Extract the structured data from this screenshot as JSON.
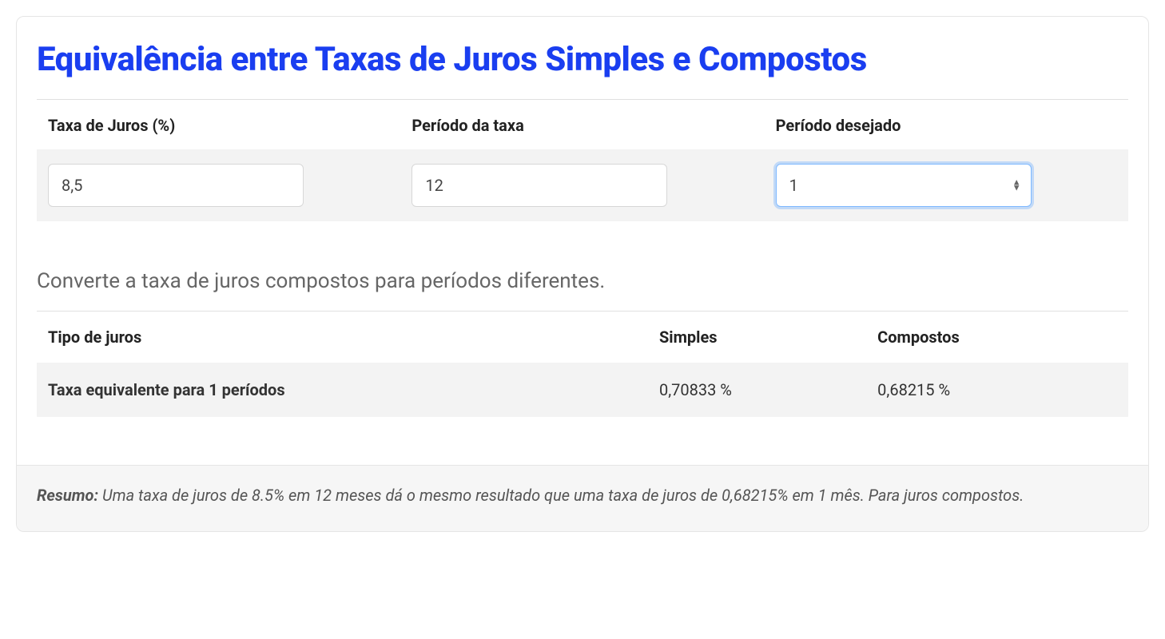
{
  "title": "Equivalência entre Taxas de Juros Simples e Compostos",
  "inputs": {
    "rate_label": "Taxa de Juros (%)",
    "rate_value": "8,5",
    "period_from_label": "Período da taxa",
    "period_from_value": "12",
    "period_to_label": "Período desejado",
    "period_to_value": "1"
  },
  "description": "Converte a taxa de juros compostos para períodos diferentes.",
  "results": {
    "header_type": "Tipo de juros",
    "header_simple": "Simples",
    "header_compound": "Compostos",
    "row_label": "Taxa equivalente para 1 períodos",
    "simple_value": "0,70833 %",
    "compound_value": "0,68215 %"
  },
  "summary": {
    "label": "Resumo:",
    "text": " Uma taxa de juros de 8.5% em 12 meses dá o mesmo resultado que uma taxa de juros de 0,68215% em 1 mês. Para juros compostos."
  }
}
